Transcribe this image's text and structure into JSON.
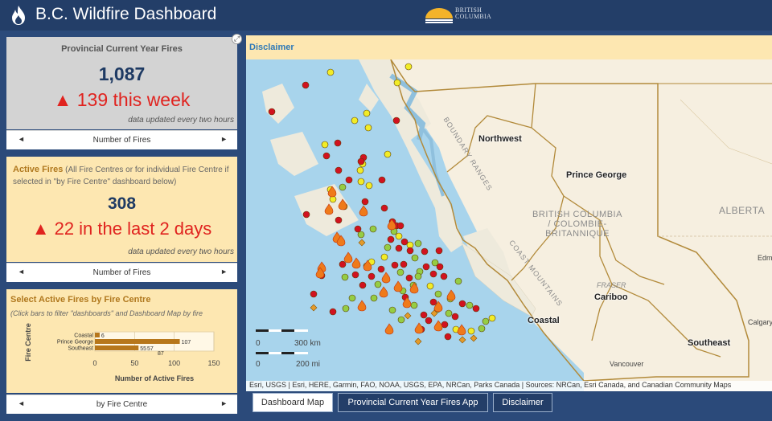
{
  "header": {
    "title": "B.C. Wildfire Dashboard",
    "logo_text_line1": "BRITISH",
    "logo_text_line2": "COLUMBIA",
    "logo_icon": "bc-sun-logo"
  },
  "cards": {
    "provincial": {
      "title": "Provincial Current Year Fires",
      "value": "1,087",
      "delta": "▲ 139 this week",
      "update_note": "data updated every two hours",
      "nav_label": "Number of Fires"
    },
    "active": {
      "title_bold": "Active Fires",
      "title_rest": " (All Fire Centres or for individual Fire Centre if selected in \"by Fire Centre\" dashboard below)",
      "value": "308",
      "delta": "▲ 22 in the last 2 days",
      "update_note": "data updated every two hours",
      "nav_label": "Number of Fires"
    },
    "by_centre": {
      "title": "Select Active Fires by Fire Centre",
      "subtitle": "(Click bars to filter \"dashboards\" and Dashboard Map by fire",
      "nav_label": "by Fire Centre"
    }
  },
  "chart_data": {
    "type": "bar",
    "orientation": "horizontal",
    "categories": [
      "Coastal",
      "Prince George",
      "Southeast"
    ],
    "values": [
      6,
      107,
      55
    ],
    "data_labels": [
      "6",
      "107",
      "55"
    ],
    "extra_data_labels": [
      "87",
      "57"
    ],
    "xlabel": "Number of Active Fires",
    "ylabel": "Fire Centre",
    "xticks": [
      "0",
      "50",
      "100",
      "150"
    ],
    "xlim": [
      0,
      150
    ],
    "bar_color": "#b7771b",
    "grid": true
  },
  "map": {
    "disclaimer_link": "Disclaimer",
    "place_labels": [
      "Northwest",
      "Prince George",
      "Cariboo",
      "Coastal",
      "Southeast"
    ],
    "region_labels": {
      "bc": [
        "BRITISH COLUMBIA",
        "/ COLOMBIE-",
        "BRITANNIQUE"
      ],
      "alberta": "ALBERTA"
    },
    "feature_labels": [
      "BOUNDARY RANGES",
      "COAST MOUNTAINS",
      "FRASER"
    ],
    "city_labels": [
      "Calgary",
      "Vancouver",
      "Edm"
    ],
    "scale": {
      "km_label": "300 km",
      "mi_label": "200 mi",
      "zero_a": "0",
      "zero_b": "0"
    },
    "attribution": "Esri, USGS | Esri, HERE, Garmin, FAO, NOAA, USGS, EPA, NRCan, Parks Canada | Sources: NRCan, Esri Canada, and Canadian Community Maps",
    "colors": {
      "water": "#a8d4ec",
      "land": "#f6efe0",
      "boundary": "#b28a3a",
      "new_fire": "#d1121f",
      "out_of_control": "#f2ec27",
      "held": "#95cd44"
    }
  },
  "tabs": [
    "Dashboard Map",
    "Provincial Current Year Fires App",
    "Disclaimer"
  ]
}
